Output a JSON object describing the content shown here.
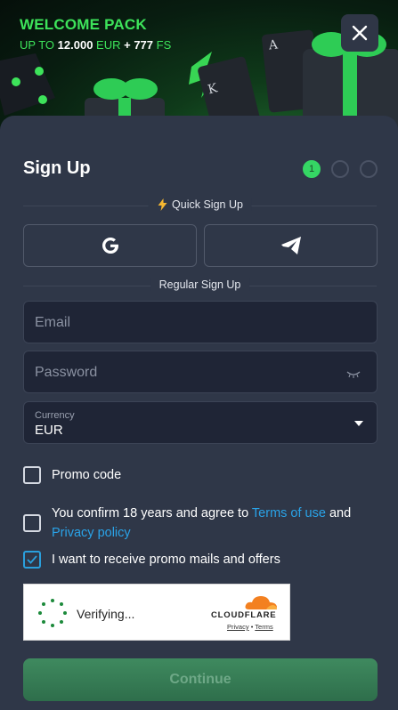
{
  "banner": {
    "title": "WELCOME PACK",
    "sub_prefix": "UP TO",
    "amount": "12.000",
    "currency": "EUR",
    "plus": "+ 777",
    "fs": "FS"
  },
  "form": {
    "title": "Sign Up",
    "steps": [
      "1",
      "",
      ""
    ],
    "quick_label": "Quick Sign Up",
    "regular_label": "Regular Sign Up",
    "email_placeholder": "Email",
    "password_placeholder": "Password",
    "currency_label": "Currency",
    "currency_value": "EUR",
    "promo_label": "Promo code",
    "terms_prefix": "You confirm 18 years and agree to",
    "terms_link": "Terms of use",
    "terms_and": "and",
    "privacy_link": "Privacy policy",
    "mails_label": "I want to receive promo mails and offers",
    "continue_label": "Continue"
  },
  "captcha": {
    "status": "Verifying...",
    "brand": "CLOUDFLARE",
    "privacy": "Privacy",
    "sep": "•",
    "terms": "Terms"
  },
  "colors": {
    "accent_green": "#35d664",
    "link_blue": "#2aa3e8",
    "panel": "#2f3748"
  },
  "icons": [
    "close-icon",
    "lightning-icon",
    "google-icon",
    "telegram-icon",
    "eye-closed-icon",
    "caret-down-icon",
    "check-icon",
    "spinner-icon",
    "cloudflare-cloud-icon",
    "dice-icon",
    "playing-card-icon",
    "gift-icon"
  ]
}
